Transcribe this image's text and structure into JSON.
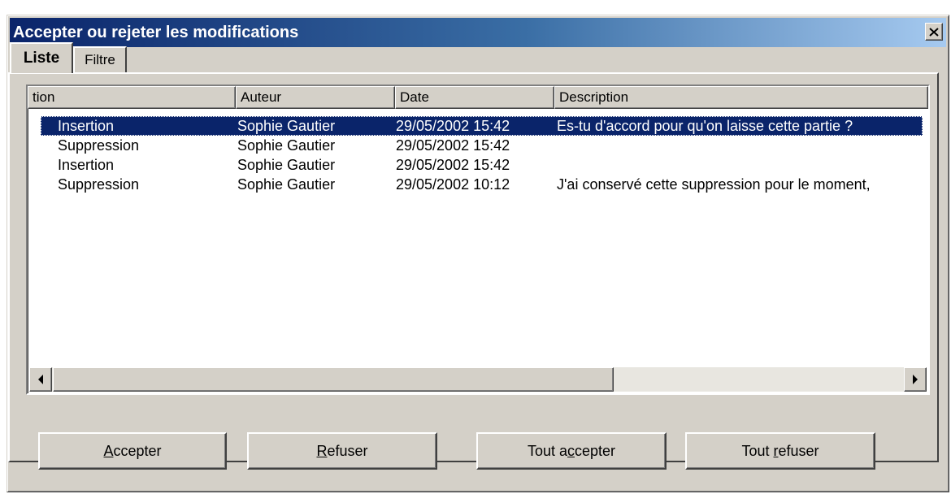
{
  "window": {
    "title": "Accepter ou rejeter les modifications"
  },
  "tabs": [
    {
      "label": "Liste",
      "active": true
    },
    {
      "label": "Filtre",
      "active": false
    }
  ],
  "list": {
    "columns": [
      "tion",
      "Auteur",
      "Date",
      "Description"
    ],
    "rows": [
      {
        "action": "Insertion",
        "author": "Sophie Gautier",
        "date": "29/05/2002 15:42",
        "description": "Es-tu d'accord pour qu'on laisse cette partie ?",
        "selected": true
      },
      {
        "action": "Suppression",
        "author": "Sophie Gautier",
        "date": "29/05/2002 15:42",
        "description": "",
        "selected": false
      },
      {
        "action": "Insertion",
        "author": "Sophie Gautier",
        "date": "29/05/2002 15:42",
        "description": "",
        "selected": false
      },
      {
        "action": "Suppression",
        "author": "Sophie Gautier",
        "date": "29/05/2002 10:12",
        "description": "J'ai conservé cette suppression pour le moment,",
        "selected": false
      }
    ]
  },
  "buttons": {
    "accept": {
      "mnemonic": "A",
      "rest": "ccepter"
    },
    "reject": {
      "mnemonic": "R",
      "rest": "efuser"
    },
    "accept_all": {
      "pre": "Tout a",
      "mnemonic": "c",
      "rest": "cepter"
    },
    "reject_all": {
      "pre": "Tout ",
      "mnemonic": "r",
      "rest": "efuser"
    }
  },
  "icons": {
    "close": "close-icon",
    "scroll_left": "arrow-left-icon",
    "scroll_right": "arrow-right-icon"
  },
  "colors": {
    "title_start": "#0a246a",
    "title_end": "#a6caf0",
    "selection": "#0a246a",
    "face": "#d4d0c8"
  }
}
